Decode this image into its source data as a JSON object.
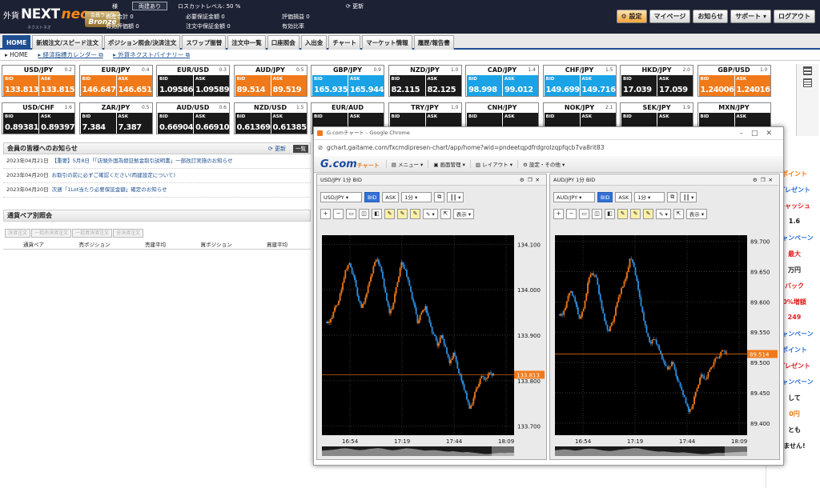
{
  "header": {
    "logo_prefix": "外貨",
    "logo_main": "NEXT",
    "logo_accent": "neo",
    "logo_sub": "ネクストネオ",
    "rank_label": "会員ランク",
    "rank_value": "Bronze",
    "user_suffix": "様",
    "mode_label": "両建あり",
    "losscut_label": "ロスカットレベル: 50 %",
    "refresh_label": "更新",
    "account_fields": [
      {
        "label": "資産合計",
        "value": "0"
      },
      {
        "label": "必要保証金額",
        "value": "0"
      },
      {
        "label": "評価損益",
        "value": "0"
      },
      {
        "label": "有効評価額",
        "value": "0"
      },
      {
        "label": "注文中保証金額",
        "value": "0"
      },
      {
        "label": "有効比率",
        "value": ""
      }
    ],
    "buttons": [
      "設定",
      "マイページ",
      "お知らせ",
      "サポート",
      "ログアウト"
    ]
  },
  "nav": {
    "tabs": [
      "HOME",
      "新規注文/スピード注文",
      "ポジション照会/決済注文",
      "スワップ振替",
      "注文中一覧",
      "口座照会",
      "入出金",
      "チャート",
      "マーケット情報",
      "履歴/報告書"
    ]
  },
  "breadcrumb": {
    "home": "HOME",
    "links": [
      "経済指標カレンダー",
      "外貨ネクストバイナリー"
    ]
  },
  "rates": [
    {
      "pair": "USD/JPY",
      "spread": "0.2",
      "bid": "133.813",
      "ask": "133.815",
      "bid_dir": "up",
      "ask_dir": "up"
    },
    {
      "pair": "EUR/JPY",
      "spread": "0.4",
      "bid": "146.647",
      "ask": "146.651",
      "bid_dir": "up",
      "ask_dir": "up"
    },
    {
      "pair": "EUR/USD",
      "spread": "0.3",
      "bid": "1.09586",
      "ask": "1.09589",
      "bid_dir": "nt",
      "ask_dir": "nt"
    },
    {
      "pair": "AUD/JPY",
      "spread": "0.5",
      "bid": "89.514",
      "ask": "89.519",
      "bid_dir": "up",
      "ask_dir": "up"
    },
    {
      "pair": "GBP/JPY",
      "spread": "0.9",
      "bid": "165.935",
      "ask": "165.944",
      "bid_dir": "dn",
      "ask_dir": "dn"
    },
    {
      "pair": "NZD/JPY",
      "spread": "1.0",
      "bid": "82.115",
      "ask": "82.125",
      "bid_dir": "nt",
      "ask_dir": "nt"
    },
    {
      "pair": "CAD/JPY",
      "spread": "1.4",
      "bid": "98.998",
      "ask": "99.012",
      "bid_dir": "dn",
      "ask_dir": "dn"
    },
    {
      "pair": "CHF/JPY",
      "spread": "1.5",
      "bid": "149.699",
      "ask": "149.716",
      "bid_dir": "dn",
      "ask_dir": "dn"
    },
    {
      "pair": "HKD/JPY",
      "spread": "2.0",
      "bid": "17.039",
      "ask": "17.059",
      "bid_dir": "nt",
      "ask_dir": "nt"
    },
    {
      "pair": "GBP/USD",
      "spread": "1.0",
      "bid": "1.24006",
      "ask": "1.24016",
      "bid_dir": "up",
      "ask_dir": "up"
    },
    {
      "pair": "USD/CHF",
      "spread": "1.6",
      "bid": "0.89381",
      "ask": "0.89397",
      "bid_dir": "nt",
      "ask_dir": "nt"
    },
    {
      "pair": "ZAR/JPY",
      "spread": "0.5",
      "bid": "7.384",
      "ask": "7.387",
      "bid_dir": "nt",
      "ask_dir": "nt"
    },
    {
      "pair": "AUD/USD",
      "spread": "0.6",
      "bid": "0.66904",
      "ask": "0.66910",
      "bid_dir": "nt",
      "ask_dir": "nt"
    },
    {
      "pair": "NZD/USD",
      "spread": "1.5",
      "bid": "0.61369",
      "ask": "0.61385",
      "bid_dir": "nt",
      "ask_dir": "nt"
    },
    {
      "pair": "EUR/AUD",
      "spread": "",
      "bid": "",
      "ask": "",
      "bid_dir": "nt",
      "ask_dir": "nt"
    },
    {
      "pair": "TRY/JPY",
      "spread": "1.0",
      "bid": "",
      "ask": "",
      "bid_dir": "nt",
      "ask_dir": "nt"
    },
    {
      "pair": "CNH/JPY",
      "spread": "",
      "bid": "",
      "ask": "",
      "bid_dir": "nt",
      "ask_dir": "nt"
    },
    {
      "pair": "NOK/JPY",
      "spread": "2.1",
      "bid": "",
      "ask": "",
      "bid_dir": "nt",
      "ask_dir": "nt"
    },
    {
      "pair": "SEK/JPY",
      "spread": "1.9",
      "bid": "",
      "ask": "",
      "bid_dir": "nt",
      "ask_dir": "nt"
    },
    {
      "pair": "MXN/JPY",
      "spread": "",
      "bid": "",
      "ask": "",
      "bid_dir": "nt",
      "ask_dir": "nt"
    }
  ],
  "notice": {
    "title": "会員の皆様へのお知らせ",
    "refresh": "更新",
    "list_btn": "一覧",
    "items": [
      {
        "date": "2023年04月21日",
        "title": "【重要】5月8日「「店頭外国為替証拠金取引説明書」一部改訂実施のお知らせ"
      },
      {
        "date": "2023年04月20日",
        "title": "お取引の前に必ずご確認ください(両建設定について)"
      },
      {
        "date": "2023年04月20日",
        "title": "次週「1Lot当たり必要保証金額」確定のお知らせ"
      }
    ]
  },
  "positions": {
    "title": "通貨ペア別照会",
    "buttons": [
      "決済注文",
      "一括売決済注文",
      "一括買決済注文",
      "全決済注文"
    ],
    "columns": [
      "通貨ペア",
      "売ポジション",
      "売建平均",
      "買ポジション",
      "買建平均"
    ]
  },
  "ads": [
    "ポイント",
    "プレゼント",
    "キャッシュ",
    "1.6",
    "キャンペーン",
    "最大",
    "万円",
    "バック",
    "0%増額",
    "249",
    "キャンペーン",
    "ポイント",
    "プレゼント",
    "キャンペーン",
    "して",
    "0円",
    "とも",
    "ません!"
  ],
  "popup": {
    "title": "G.comチャート - Google Chrome",
    "url": "gchart.gaitame.com/fxcmdipresen-chart/app/home?wid=pndeetqpdfrdgrolzqpfqcb7va8rit83",
    "brand": "G.com",
    "brand_sub": "チャート",
    "menus": [
      "メニュー",
      "画面管理",
      "レイアウト",
      "設定・その他"
    ]
  },
  "charts": [
    {
      "header": "USD/JPY 1分 BID",
      "pair_select": "USD/JPY",
      "bid": "BID",
      "ask": "ASK",
      "interval": "1分",
      "display": "表示",
      "price_label": "133.813"
    },
    {
      "header": "AUD/JPY 1分 BID",
      "pair_select": "AUD/JPY",
      "bid": "BID",
      "ask": "ASK",
      "interval": "1分",
      "display": "表示",
      "price_label": "89.514"
    }
  ],
  "chart_data": [
    {
      "type": "candlestick",
      "title": "USD/JPY 1分 BID",
      "x_ticks": [
        "16:54",
        "17:19",
        "17:44",
        "18:09"
      ],
      "y_ticks": [
        133.7,
        133.8,
        133.9,
        134.0,
        134.1
      ],
      "ylim": [
        133.68,
        134.12
      ],
      "current": 133.813,
      "close_path": [
        133.93,
        133.95,
        133.97,
        134.0,
        134.04,
        134.06,
        134.03,
        133.99,
        133.96,
        133.98,
        134.02,
        134.05,
        134.07,
        134.04,
        133.99,
        133.95,
        133.97,
        134.02,
        134.06,
        134.04,
        134.01,
        133.97,
        133.93,
        133.95,
        133.96,
        133.93,
        133.9,
        133.88,
        133.9,
        133.87,
        133.84,
        133.86,
        133.83,
        133.8,
        133.77,
        133.74,
        133.76,
        133.79,
        133.81,
        133.8,
        133.82,
        133.813
      ],
      "colors": {
        "up": "#f07a1a",
        "down": "#2f8fe0",
        "background": "#000000"
      }
    },
    {
      "type": "candlestick",
      "title": "AUD/JPY 1分 BID",
      "x_ticks": [
        "16:54",
        "17:19",
        "17:44",
        "18:09"
      ],
      "y_ticks": [
        89.4,
        89.45,
        89.5,
        89.55,
        89.6,
        89.65,
        89.7
      ],
      "ylim": [
        89.38,
        89.71
      ],
      "current": 89.514,
      "close_path": [
        89.58,
        89.6,
        89.62,
        89.6,
        89.57,
        89.59,
        89.63,
        89.65,
        89.64,
        89.6,
        89.57,
        89.55,
        89.57,
        89.6,
        89.62,
        89.64,
        89.67,
        89.66,
        89.62,
        89.58,
        89.55,
        89.53,
        89.54,
        89.52,
        89.5,
        89.49,
        89.5,
        89.48,
        89.46,
        89.44,
        89.42,
        89.43,
        89.46,
        89.48,
        89.47,
        89.49,
        89.5,
        89.51,
        89.52,
        89.514
      ],
      "colors": {
        "up": "#f07a1a",
        "down": "#2f8fe0",
        "background": "#000000"
      }
    }
  ]
}
